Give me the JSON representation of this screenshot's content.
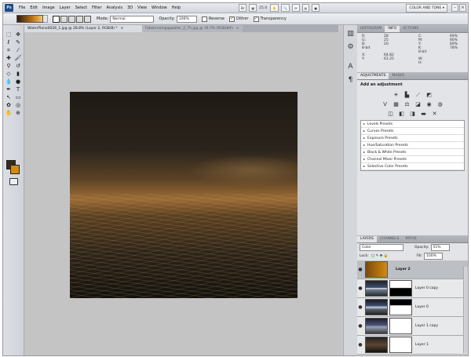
{
  "menubar": {
    "logo": "Ps",
    "items": [
      "File",
      "Edit",
      "Image",
      "Layer",
      "Select",
      "Filter",
      "Analysis",
      "3D",
      "View",
      "Window",
      "Help"
    ],
    "zoom": "25.0",
    "workspace": "COLOR AND TONE ▾"
  },
  "options": {
    "mode_label": "Mode:",
    "mode_value": "Normal",
    "opacity_label": "Opacity:",
    "opacity_value": "100%",
    "reverse": "Reverse",
    "dither": "Dither",
    "transparency": "Transparency"
  },
  "doctabs": [
    {
      "label": "WaterPlane0026_1.jpg @ 28.8% (Layer 2, RGB/8) *",
      "close": "×"
    },
    {
      "label": "Fabienne/ngapwater_2_75.jpg @ 16.7% (RGB/8#)",
      "close": "×"
    }
  ],
  "panels": {
    "top_tabs": [
      "HISTOGRAM",
      "INFO",
      "ACTIONS"
    ],
    "info": {
      "left": [
        "R:",
        "G:",
        "B:",
        "8-bit"
      ],
      "left_vals": [
        "28",
        "25",
        "20",
        ""
      ],
      "right": [
        "C:",
        "M:",
        "Y:",
        "K:",
        "8-bit"
      ],
      "right_vals": [
        "69%",
        "66%",
        "69%",
        "78%",
        ""
      ],
      "xy": [
        "X:",
        "Y:"
      ],
      "xy_vals": [
        "64.82",
        "61.25"
      ],
      "wh": [
        "W:",
        "H:"
      ]
    },
    "adj_tabs": [
      "ADJUSTMENTS",
      "MASKS"
    ],
    "adj_title": "Add an adjustment",
    "presets": [
      "Levels Presets",
      "Curves Presets",
      "Exposure Presets",
      "Hue/Saturation Presets",
      "Black & White Presets",
      "Channel Mixer Presets",
      "Selective Color Presets"
    ],
    "layer_tabs": [
      "LAYERS",
      "CHANNELS",
      "PATHS"
    ],
    "blend": "Color",
    "opacity_label": "Opacity:",
    "opacity": "51%",
    "lock_label": "Lock:",
    "fill_label": "Fill:",
    "fill": "100%",
    "layers": [
      "Layer 2",
      "Layer 0 copy",
      "Layer 0",
      "Layer 1 copy",
      "Layer 1"
    ]
  },
  "colors": {
    "foreground": "#3a2a18",
    "background": "#d48a0e"
  }
}
